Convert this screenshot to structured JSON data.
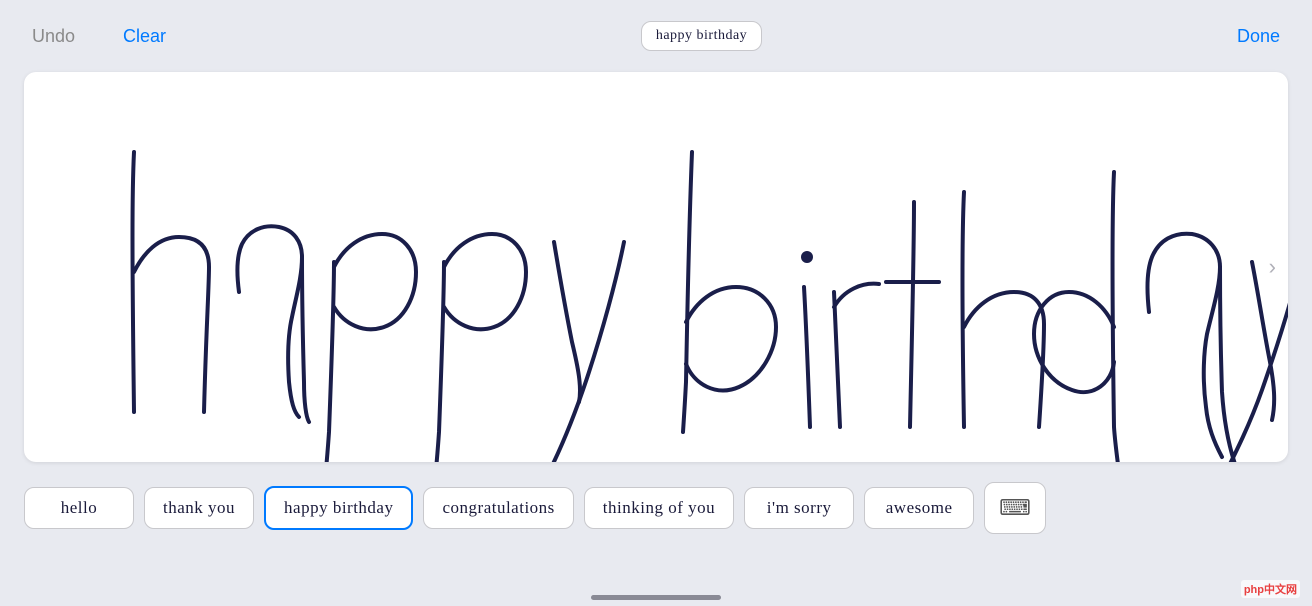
{
  "toolbar": {
    "undo_label": "Undo",
    "clear_label": "Clear",
    "done_label": "Done",
    "preview_text": "happy birthday"
  },
  "suggestions": [
    {
      "id": "hello",
      "label": "hello",
      "active": false
    },
    {
      "id": "thank-you",
      "label": "thank you",
      "active": false
    },
    {
      "id": "happy-birthday",
      "label": "happy birthday",
      "active": true
    },
    {
      "id": "congratulations",
      "label": "congratulations",
      "active": false
    },
    {
      "id": "thinking-of-you",
      "label": "thinking of you",
      "active": false
    },
    {
      "id": "im-sorry",
      "label": "i'm sorry",
      "active": false
    },
    {
      "id": "awesome",
      "label": "awesome",
      "active": false
    }
  ],
  "canvas": {
    "text": "happy birthday"
  },
  "watermark": "php中文网"
}
